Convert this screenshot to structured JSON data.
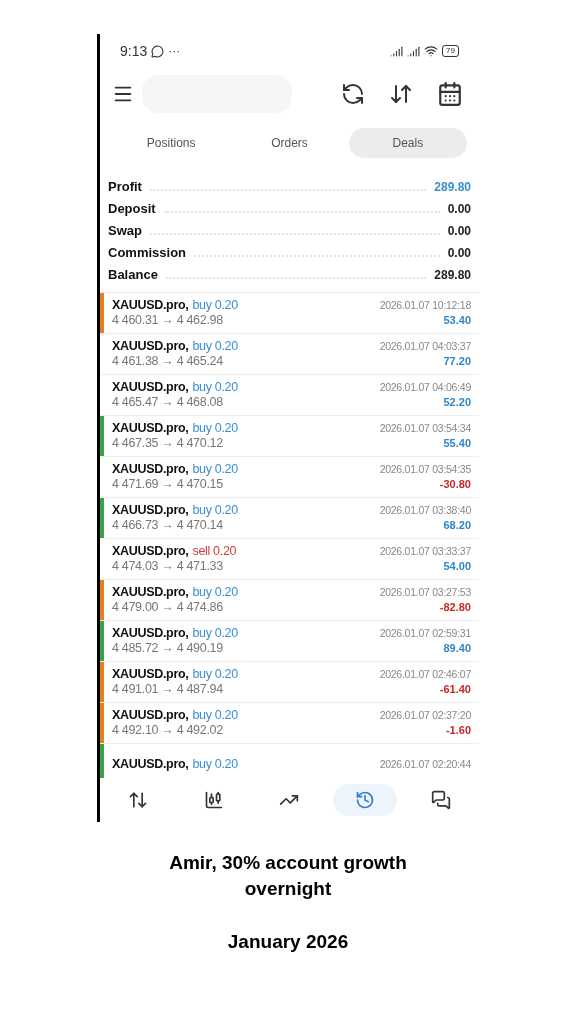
{
  "status_bar": {
    "time": "9:13",
    "more": "···",
    "battery": "79"
  },
  "tabs": [
    {
      "label": "Positions",
      "selected": false
    },
    {
      "label": "Orders",
      "selected": false
    },
    {
      "label": "Deals",
      "selected": true
    }
  ],
  "summary": [
    {
      "label": "Profit",
      "value": "289.80",
      "highlight": true
    },
    {
      "label": "Deposit",
      "value": "0.00",
      "highlight": false
    },
    {
      "label": "Swap",
      "value": "0.00",
      "highlight": false
    },
    {
      "label": "Commission",
      "value": "0.00",
      "highlight": false
    },
    {
      "label": "Balance",
      "value": "289.80",
      "highlight": false
    }
  ],
  "deals": [
    {
      "symbol": "XAUUSD.pro,",
      "trade": "buy 0.20",
      "sell": false,
      "prices": "4 460.31 → 4 462.98",
      "time": "2026.01.07 10:12:18",
      "profit": "53.40",
      "loss": false,
      "color": "#e67e22"
    },
    {
      "symbol": "XAUUSD.pro,",
      "trade": "buy 0.20",
      "sell": false,
      "prices": "4 461.38 → 4 465.24",
      "time": "2026.01.07 04:03:37",
      "profit": "77.20",
      "loss": false
    },
    {
      "symbol": "XAUUSD.pro,",
      "trade": "buy 0.20",
      "sell": false,
      "prices": "4 465.47 → 4 468.08",
      "time": "2026.01.07 04:06:49",
      "profit": "52.20",
      "loss": false
    },
    {
      "symbol": "XAUUSD.pro,",
      "trade": "buy 0.20",
      "sell": false,
      "prices": "4 467.35 → 4 470.12",
      "time": "2026.01.07 03:54:34",
      "profit": "55.40",
      "loss": false,
      "color": "#3aa346"
    },
    {
      "symbol": "XAUUSD.pro,",
      "trade": "buy 0.20",
      "sell": false,
      "prices": "4 471.69 → 4 470.15",
      "time": "2026.01.07 03:54:35",
      "profit": "-30.80",
      "loss": true
    },
    {
      "symbol": "XAUUSD.pro,",
      "trade": "buy 0.20",
      "sell": false,
      "prices": "4 466.73 → 4 470.14",
      "time": "2026.01.07 03:38:40",
      "profit": "68.20",
      "loss": false,
      "color": "#3aa346"
    },
    {
      "symbol": "XAUUSD.pro,",
      "trade": "sell 0.20",
      "sell": true,
      "prices": "4 474.03 → 4 471.33",
      "time": "2026.01.07 03:33:37",
      "profit": "54.00",
      "loss": false
    },
    {
      "symbol": "XAUUSD.pro,",
      "trade": "buy 0.20",
      "sell": false,
      "prices": "4 479.00 → 4 474.86",
      "time": "2026.01.07 03:27:53",
      "profit": "-82.80",
      "loss": true,
      "color": "#e67e22"
    },
    {
      "symbol": "XAUUSD.pro,",
      "trade": "buy 0.20",
      "sell": false,
      "prices": "4 485.72 → 4 490.19",
      "time": "2026.01.07 02:59:31",
      "profit": "89.40",
      "loss": false,
      "color": "#3aa346"
    },
    {
      "symbol": "XAUUSD.pro,",
      "trade": "buy 0.20",
      "sell": false,
      "prices": "4 491.01 → 4 487.94",
      "time": "2026.01.07 02:46:07",
      "profit": "-61.40",
      "loss": true,
      "color": "#e67e22"
    },
    {
      "symbol": "XAUUSD.pro,",
      "trade": "buy 0.20",
      "sell": false,
      "prices": "4 492.10 → 4 492.02",
      "time": "2026.01.07 02:37:20",
      "profit": "-1.60",
      "loss": true,
      "color": "#e67e22"
    },
    {
      "symbol": "XAUUSD.pro,",
      "trade": "buy 0.20",
      "sell": false,
      "time": "2026.01.07 02:20:44",
      "color": "#3aa346"
    }
  ],
  "nav": [
    {
      "kind": "quotes",
      "selected": false
    },
    {
      "kind": "chart",
      "selected": false
    },
    {
      "kind": "trade",
      "selected": false
    },
    {
      "kind": "history",
      "selected": true
    },
    {
      "kind": "messages",
      "selected": false
    }
  ],
  "caption": {
    "title": "Amir, 30% account growth overnight",
    "date": "January 2026"
  }
}
